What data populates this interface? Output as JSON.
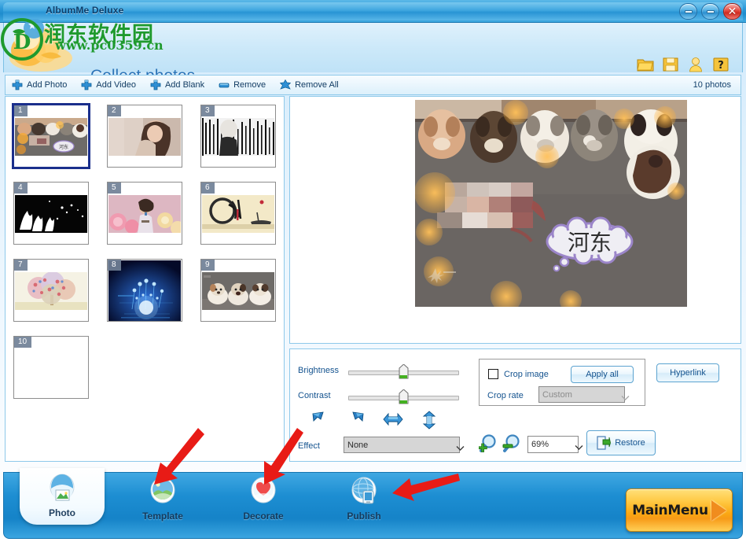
{
  "window": {
    "title": "AlbumMe Deluxe",
    "minimize_label": "Minimize",
    "maximize_label": "Maximize",
    "close_label": "Close"
  },
  "watermark": {
    "line1": "润东软件园",
    "line2": "www.pc0359.cn",
    "color": "#1f9a2e"
  },
  "header": {
    "page_title": "Collect photos",
    "icons": [
      {
        "name": "open-folder-icon",
        "label": "Open"
      },
      {
        "name": "save-icon",
        "label": "Save"
      },
      {
        "name": "user-icon",
        "label": "User"
      },
      {
        "name": "help-icon",
        "label": "Help"
      }
    ]
  },
  "toolbar": {
    "items": [
      {
        "name": "add-photo",
        "label": "Add Photo",
        "icon": "plus-cross-icon"
      },
      {
        "name": "add-video",
        "label": "Add Video",
        "icon": "plus-cross-icon"
      },
      {
        "name": "add-blank",
        "label": "Add Blank",
        "icon": "plus-cross-icon"
      },
      {
        "name": "remove",
        "label": "Remove",
        "icon": "minus-bar-icon"
      },
      {
        "name": "remove-all",
        "label": "Remove All",
        "icon": "star-cross-icon"
      }
    ],
    "photo_count": "10 photos"
  },
  "thumbnails": [
    {
      "num": "1",
      "kind": "puppies-bokeh",
      "selected": true
    },
    {
      "num": "2",
      "kind": "woman-portrait",
      "selected": false
    },
    {
      "num": "3",
      "kind": "bw-texture",
      "selected": false
    },
    {
      "num": "4",
      "kind": "black-white-splash",
      "selected": false
    },
    {
      "num": "5",
      "kind": "girl-flowers",
      "selected": false
    },
    {
      "num": "6",
      "kind": "ink-painting",
      "selected": false
    },
    {
      "num": "7",
      "kind": "flower-tree",
      "selected": false
    },
    {
      "num": "8",
      "kind": "blue-tech-hand",
      "selected": false
    },
    {
      "num": "9",
      "kind": "three-puppies",
      "selected": false
    },
    {
      "num": "10",
      "kind": "blank",
      "selected": false
    }
  ],
  "preview": {
    "caption_text": "河东",
    "alt": "Upside-down photo of puppies on a wooden bench with bokeh overlay"
  },
  "edit_panel": {
    "brightness_label": "Brightness",
    "brightness_value": 50,
    "contrast_label": "Contrast",
    "contrast_value": 50,
    "transform_buttons": [
      {
        "name": "rotate-right-icon",
        "label": "Rotate right"
      },
      {
        "name": "rotate-left-icon",
        "label": "Rotate left"
      },
      {
        "name": "flip-horizontal-icon",
        "label": "Flip horizontal"
      },
      {
        "name": "flip-vertical-icon",
        "label": "Flip vertical"
      }
    ],
    "effect_label": "Effect",
    "effect_value": "None",
    "crop_image_label": "Crop image",
    "crop_image_checked": false,
    "apply_all_label": "Apply all",
    "crop_rate_label": "Crop rate",
    "crop_rate_value": "Custom",
    "hyperlink_label": "Hyperlink",
    "zoom_in_label": "Zoom in",
    "zoom_out_label": "Zoom out",
    "zoom_value": "69%",
    "restore_label": "Restore"
  },
  "bottom_nav": {
    "tabs": [
      {
        "name": "photo",
        "label": "Photo",
        "active": true
      },
      {
        "name": "template",
        "label": "Template",
        "active": false
      },
      {
        "name": "decorate",
        "label": "Decorate",
        "active": false
      },
      {
        "name": "publish",
        "label": "Publish",
        "active": false
      }
    ],
    "main_menu_label": "MainMenu"
  },
  "annotations": {
    "arrow_color": "#e81b16",
    "arrows": [
      {
        "name": "arrow-to-template"
      },
      {
        "name": "arrow-to-decorate"
      },
      {
        "name": "arrow-to-publish"
      }
    ]
  }
}
